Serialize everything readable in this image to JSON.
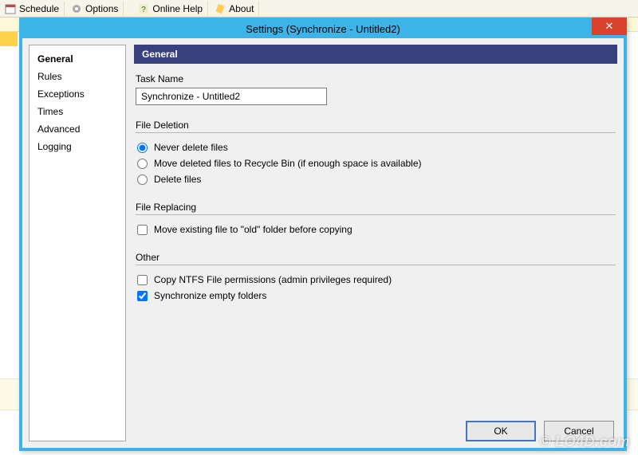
{
  "background_toolbar": {
    "schedule": "Schedule",
    "options": "Options",
    "online_help": "Online Help",
    "about": "About"
  },
  "dialog": {
    "title": "Settings (Synchronize - Untitled2)",
    "close_label": "✕"
  },
  "sidebar": {
    "items": [
      {
        "label": "General",
        "selected": true
      },
      {
        "label": "Rules",
        "selected": false
      },
      {
        "label": "Exceptions",
        "selected": false
      },
      {
        "label": "Times",
        "selected": false
      },
      {
        "label": "Advanced",
        "selected": false
      },
      {
        "label": "Logging",
        "selected": false
      }
    ]
  },
  "content": {
    "section_header": "General",
    "task_name_label": "Task Name",
    "task_name_value": "Synchronize - Untitled2",
    "groups": {
      "file_deletion": {
        "title": "File Deletion",
        "options": [
          {
            "label": "Never delete files",
            "checked": true
          },
          {
            "label": "Move deleted files to Recycle Bin (if enough space is available)",
            "checked": false
          },
          {
            "label": "Delete files",
            "checked": false
          }
        ]
      },
      "file_replacing": {
        "title": "File Replacing",
        "options": [
          {
            "label": "Move existing file to \"old\" folder before copying",
            "checked": false
          }
        ]
      },
      "other": {
        "title": "Other",
        "options": [
          {
            "label": "Copy NTFS File permissions (admin privileges required)",
            "checked": false
          },
          {
            "label": "Synchronize empty folders",
            "checked": true
          }
        ]
      }
    }
  },
  "buttons": {
    "ok": "OK",
    "cancel": "Cancel"
  },
  "watermark": "© LO4D.com"
}
